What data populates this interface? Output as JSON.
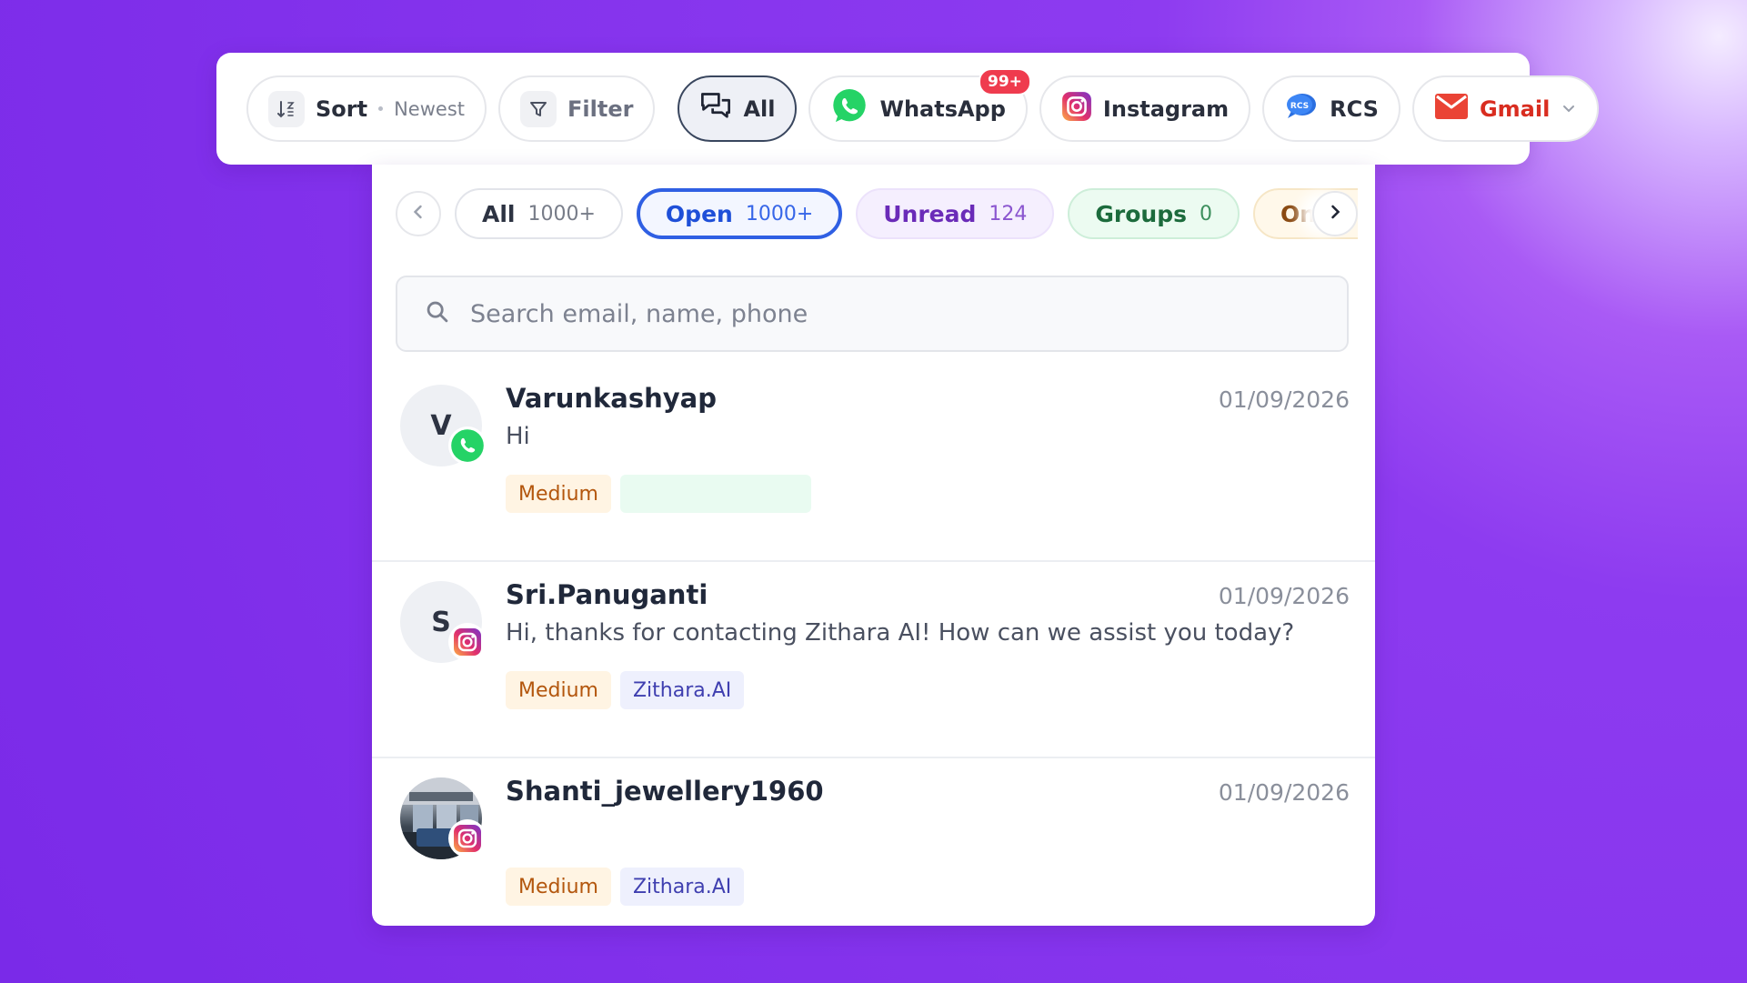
{
  "topbar": {
    "sort_label": "Sort",
    "sort_value": "Newest",
    "filter_label": "Filter",
    "channels": [
      {
        "label": "All",
        "icon": "chat-bubbles-icon",
        "active": true
      },
      {
        "label": "WhatsApp",
        "icon": "whatsapp-icon",
        "badge": "99+"
      },
      {
        "label": "Instagram",
        "icon": "instagram-icon"
      },
      {
        "label": "RCS",
        "icon": "rcs-icon"
      },
      {
        "label": "Gmail",
        "icon": "gmail-icon"
      }
    ]
  },
  "tabs": [
    {
      "label": "All",
      "count": "1000+"
    },
    {
      "label": "Open",
      "count": "1000+",
      "selected": true
    },
    {
      "label": "Unread",
      "count": "124"
    },
    {
      "label": "Groups",
      "count": "0"
    },
    {
      "label": "On ho"
    }
  ],
  "search": {
    "placeholder": "Search email, name, phone"
  },
  "conversations": [
    {
      "initial": "V",
      "name": "Varunkashyap",
      "date": "01/09/2026",
      "preview": "Hi",
      "channel": "whatsapp-icon",
      "tags": [
        "Medium"
      ]
    },
    {
      "initial": "S",
      "name": "Sri.Panuganti",
      "date": "01/09/2026",
      "preview": "Hi, thanks for contacting Zithara AI! How can we assist you today?",
      "channel": "instagram-icon",
      "tags": [
        "Medium",
        "Zithara.AI"
      ]
    },
    {
      "name": "Shanti_jewellery1960",
      "date": "01/09/2026",
      "preview": "",
      "channel": "instagram-icon",
      "tags": [
        "Medium",
        "Zithara.AI"
      ]
    }
  ],
  "colors": {
    "accent_blue": "#2f5fe3",
    "whatsapp_green": "#25d366",
    "gmail_red": "#d92d20",
    "badge_red": "#ef3b4e",
    "background_purple": "#8d3bf0"
  }
}
